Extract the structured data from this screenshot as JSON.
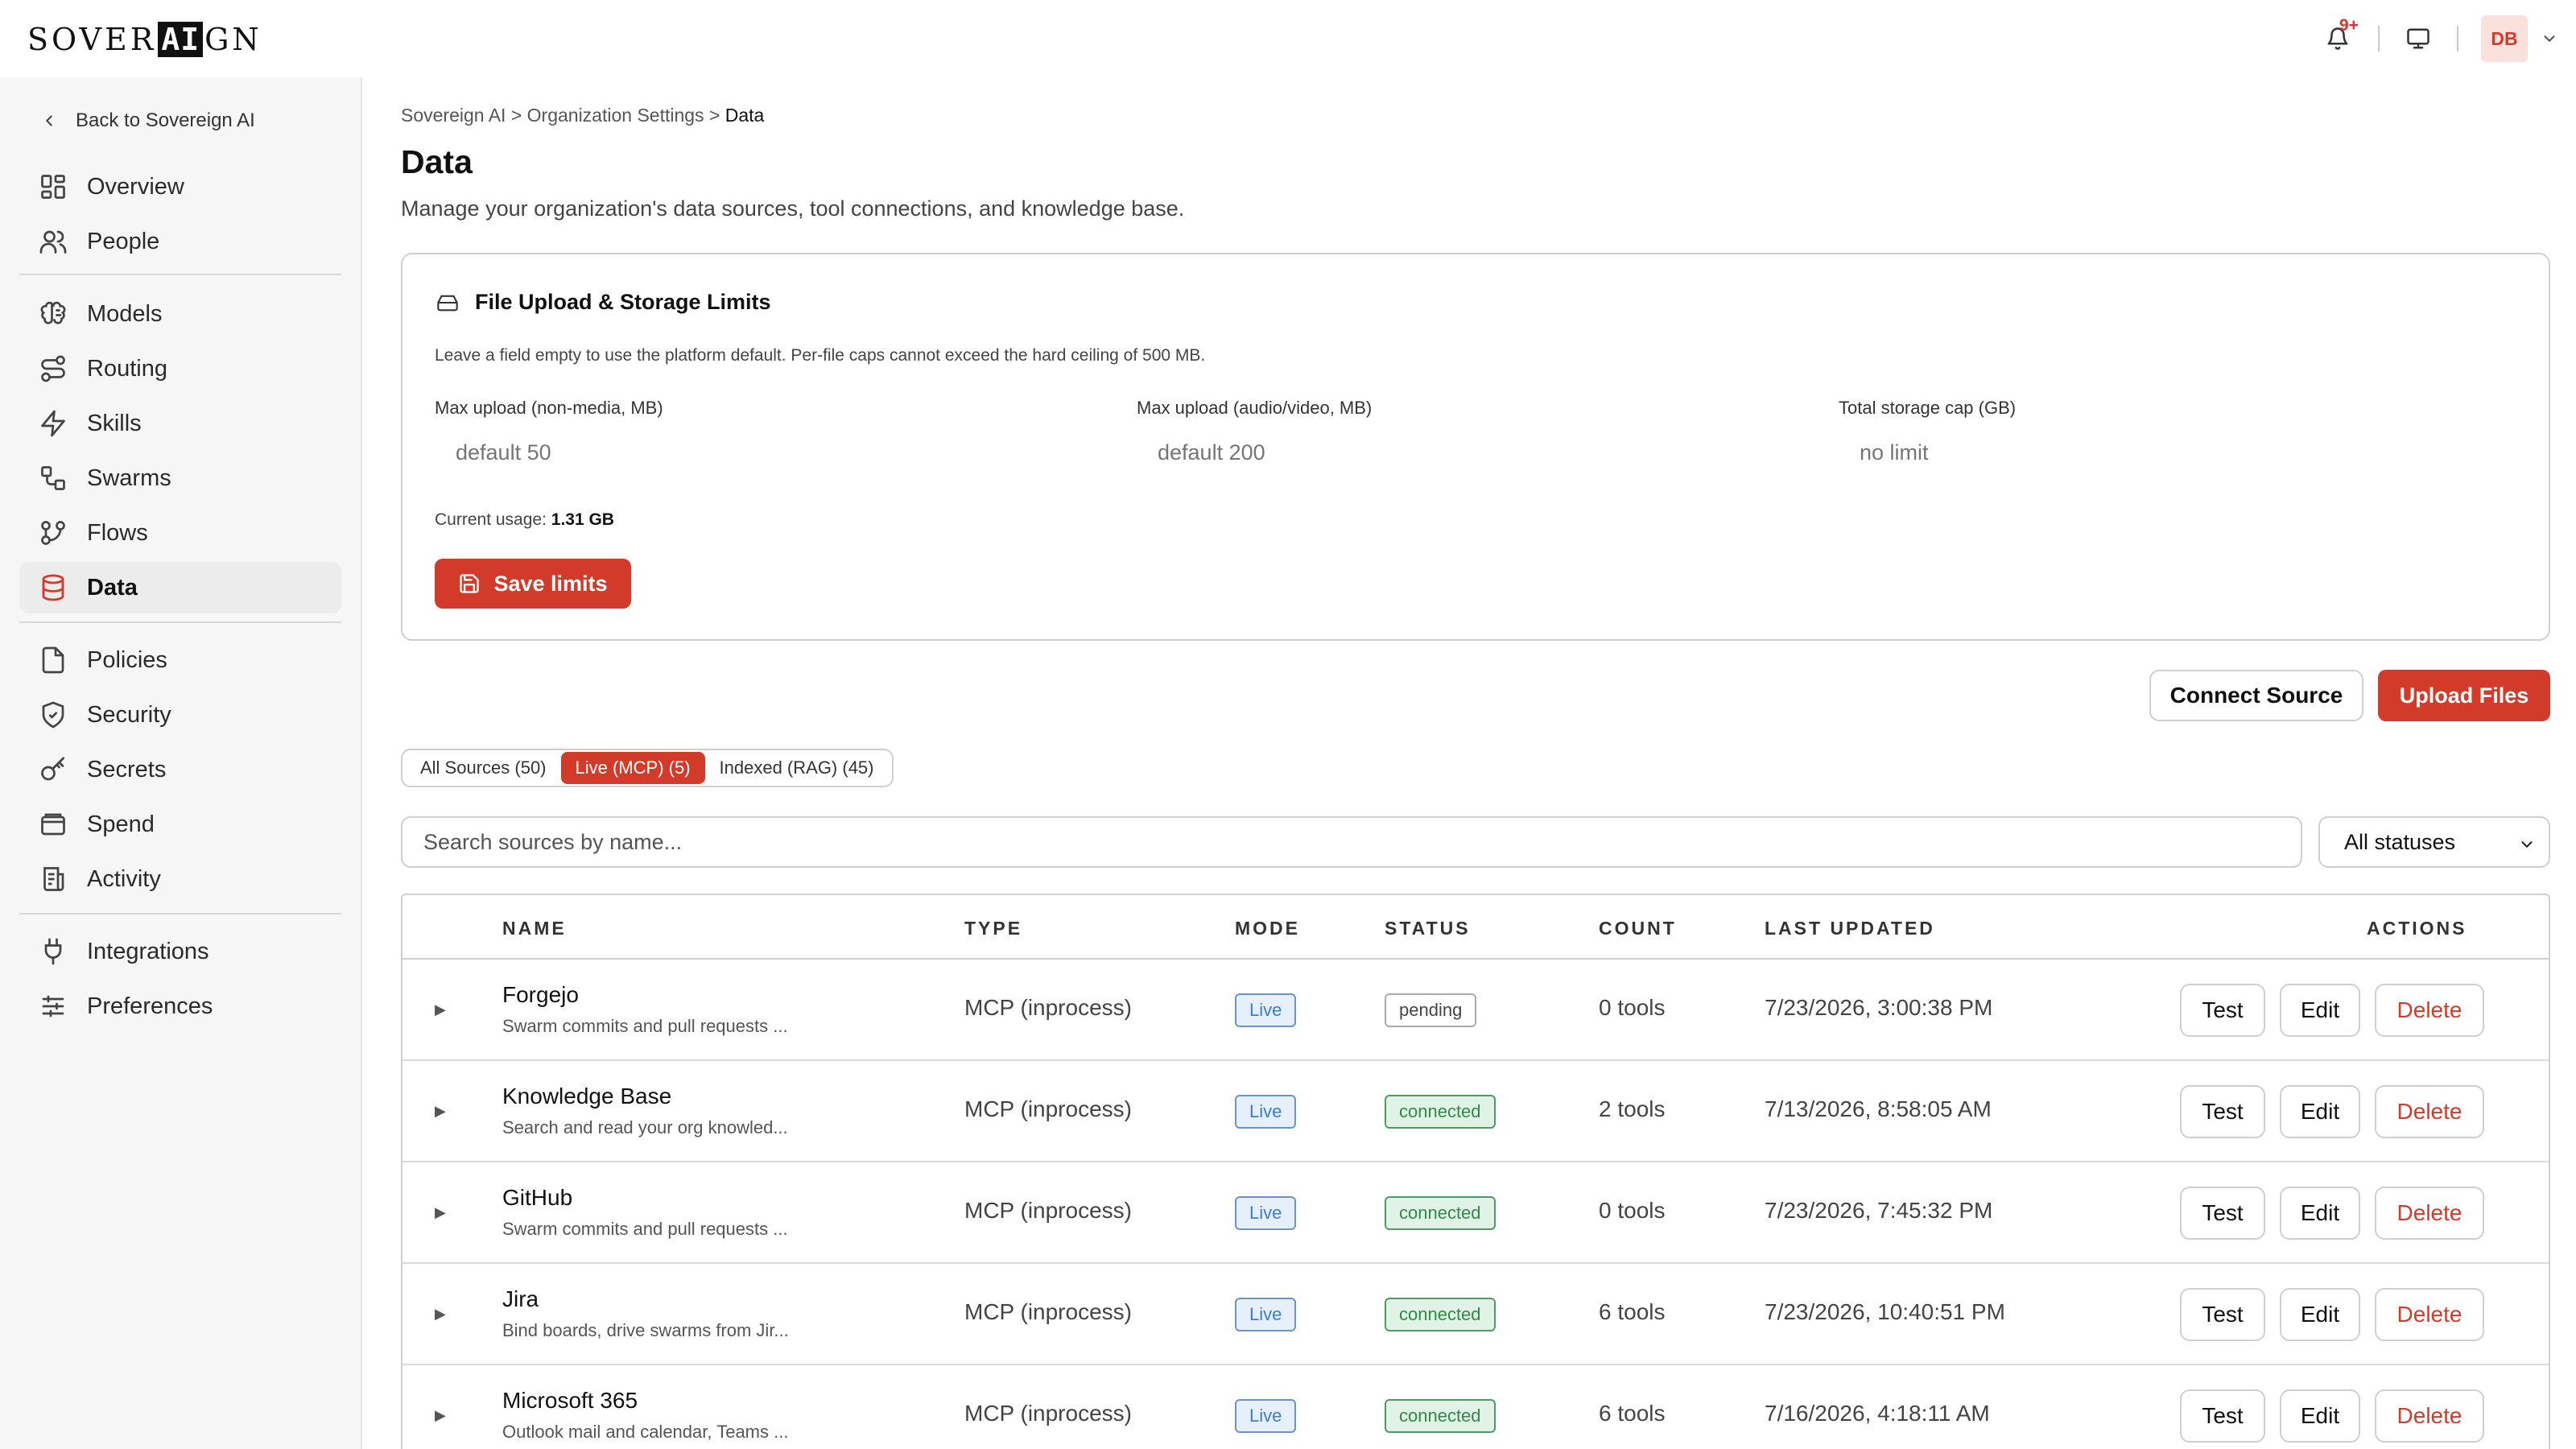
{
  "brand": {
    "logo_left": "SOVER",
    "logo_mid": "AI",
    "logo_right": "GN",
    "accent": "#d23a2a"
  },
  "topbar": {
    "notif_badge": "9+",
    "user_initials": "DB"
  },
  "sidebar": {
    "back_label": "Back to Sovereign AI",
    "items": [
      {
        "label": "Overview",
        "icon": "grid-icon"
      },
      {
        "label": "People",
        "icon": "users-icon"
      },
      {
        "label": "Models",
        "icon": "brain-icon"
      },
      {
        "label": "Routing",
        "icon": "route-icon"
      },
      {
        "label": "Skills",
        "icon": "bolt-icon"
      },
      {
        "label": "Swarms",
        "icon": "nodes-icon"
      },
      {
        "label": "Flows",
        "icon": "branch-icon"
      },
      {
        "label": "Data",
        "icon": "database-icon",
        "active": true
      },
      {
        "label": "Policies",
        "icon": "document-icon"
      },
      {
        "label": "Security",
        "icon": "shield-icon"
      },
      {
        "label": "Secrets",
        "icon": "key-icon"
      },
      {
        "label": "Spend",
        "icon": "wallet-icon"
      },
      {
        "label": "Activity",
        "icon": "receipt-icon"
      },
      {
        "label": "Integrations",
        "icon": "plug-icon"
      },
      {
        "label": "Preferences",
        "icon": "sliders-icon"
      }
    ]
  },
  "breadcrumb": {
    "root": "Sovereign AI",
    "sep": ">",
    "mid": "Organization Settings",
    "current": "Data"
  },
  "page": {
    "title": "Data",
    "subtitle": "Manage your organization's data sources, tool connections, and knowledge base."
  },
  "limits": {
    "title": "File Upload & Storage Limits",
    "description": "Leave a field empty to use the platform default. Per-file caps cannot exceed the hard ceiling of 500 MB.",
    "fields": [
      {
        "label": "Max upload (non-media, MB)",
        "placeholder": "default 50"
      },
      {
        "label": "Max upload (audio/video, MB)",
        "placeholder": "default 200"
      },
      {
        "label": "Total storage cap (GB)",
        "placeholder": "no limit"
      }
    ],
    "usage_label": "Current usage:",
    "usage_value": "1.31 GB",
    "save_label": "Save limits"
  },
  "actions": {
    "connect_label": "Connect Source",
    "upload_label": "Upload Files"
  },
  "tabs": [
    {
      "label": "All Sources (50)"
    },
    {
      "label": "Live (MCP) (5)",
      "active": true
    },
    {
      "label": "Indexed (RAG) (45)"
    }
  ],
  "search": {
    "placeholder": "Search sources by name...",
    "status_filter": "All statuses"
  },
  "table": {
    "columns": [
      "NAME",
      "TYPE",
      "MODE",
      "STATUS",
      "COUNT",
      "LAST UPDATED",
      "ACTIONS"
    ],
    "action_labels": {
      "test": "Test",
      "edit": "Edit",
      "delete": "Delete"
    },
    "rows": [
      {
        "name": "Forgejo",
        "desc": "Swarm commits and pull requests ...",
        "type": "MCP (inprocess)",
        "mode": "Live",
        "status": "pending",
        "count": "0 tools",
        "updated": "7/23/2026, 3:00:38 PM"
      },
      {
        "name": "Knowledge Base",
        "desc": "Search and read your org knowled...",
        "type": "MCP (inprocess)",
        "mode": "Live",
        "status": "connected",
        "count": "2 tools",
        "updated": "7/13/2026, 8:58:05 AM"
      },
      {
        "name": "GitHub",
        "desc": "Swarm commits and pull requests ...",
        "type": "MCP (inprocess)",
        "mode": "Live",
        "status": "connected",
        "count": "0 tools",
        "updated": "7/23/2026, 7:45:32 PM"
      },
      {
        "name": "Jira",
        "desc": "Bind boards, drive swarms from Jir...",
        "type": "MCP (inprocess)",
        "mode": "Live",
        "status": "connected",
        "count": "6 tools",
        "updated": "7/23/2026, 10:40:51 PM"
      },
      {
        "name": "Microsoft 365",
        "desc": "Outlook mail and calendar, Teams ...",
        "type": "MCP (inprocess)",
        "mode": "Live",
        "status": "connected",
        "count": "6 tools",
        "updated": "7/16/2026, 4:18:11 AM"
      }
    ]
  }
}
